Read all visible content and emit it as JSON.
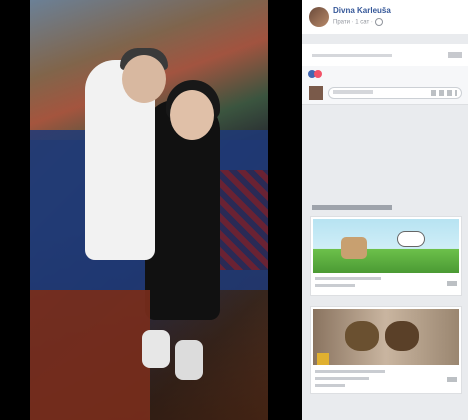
{
  "post": {
    "author": "Divna Karleuša",
    "meta_time": "Прати · 1 сат ·"
  },
  "colors": {
    "accent": "#365899",
    "panel_bg": "#e9ebee",
    "like_blue": "#4267b2",
    "love_red": "#f25268"
  },
  "icons": [
    "globe-icon",
    "like-reaction-icon",
    "love-reaction-icon"
  ]
}
